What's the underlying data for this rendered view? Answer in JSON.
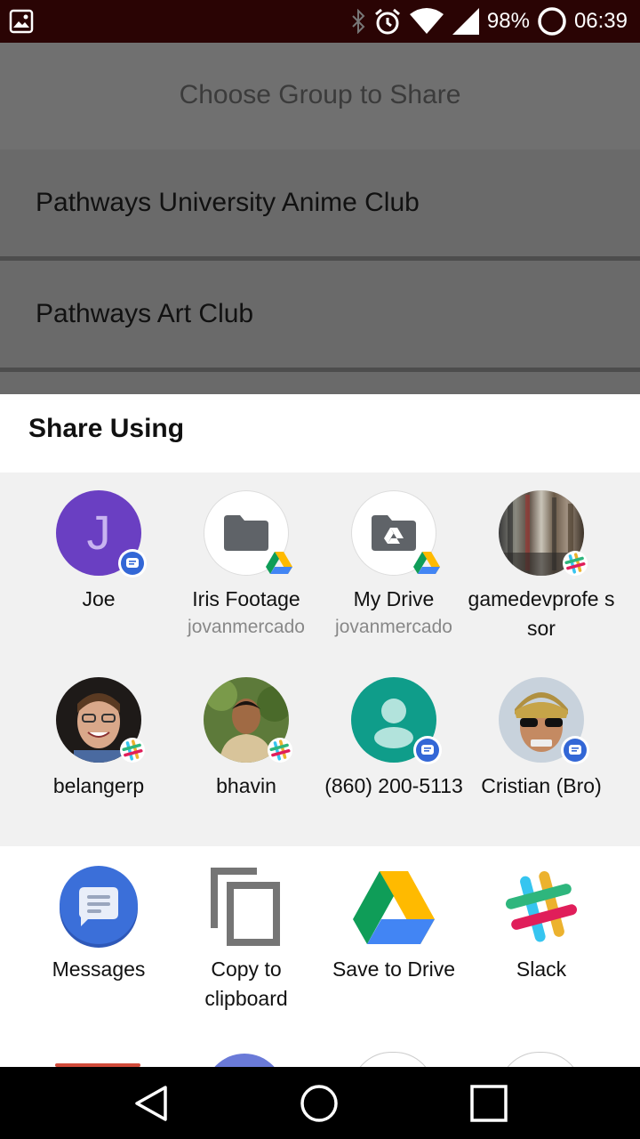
{
  "status_bar": {
    "battery": "98%",
    "time": "06:39",
    "icons": [
      "gallery-icon",
      "bluetooth-icon",
      "alarm-icon",
      "wifi-icon",
      "signal-icon",
      "battery-icon"
    ]
  },
  "app": {
    "title": "Choose Group to Share",
    "groups": [
      "Pathways University Anime Club",
      "Pathways Art Club"
    ]
  },
  "share_sheet": {
    "title": "Share Using",
    "direct_targets": [
      {
        "name": "Joe",
        "sub": "",
        "avatar_letter": "J",
        "badge": "messages-badge-icon"
      },
      {
        "name": "Iris Footage",
        "sub": "jovanmercado",
        "badge": "drive-badge-icon"
      },
      {
        "name": "My Drive",
        "sub": "jovanmercado",
        "badge": "drive-badge-icon"
      },
      {
        "name": "gamedevprofe ssor",
        "sub": "",
        "badge": "slack-badge-icon"
      },
      {
        "name": "belangerp",
        "sub": "",
        "badge": "slack-badge-icon"
      },
      {
        "name": "bhavin",
        "sub": "",
        "badge": "slack-badge-icon"
      },
      {
        "name": "(860) 200-5113",
        "sub": "",
        "badge": "messages-badge-icon"
      },
      {
        "name": "Cristian (Bro)",
        "sub": "",
        "badge": "messages-badge-icon"
      }
    ],
    "apps": [
      {
        "label": "Messages",
        "icon": "messages-app-icon"
      },
      {
        "label": "Copy to clipboard",
        "icon": "copy-icon"
      },
      {
        "label": "Save to Drive",
        "icon": "drive-app-icon"
      },
      {
        "label": "Slack",
        "icon": "slack-app-icon"
      }
    ]
  },
  "colors": {
    "joe_avatar": "#6a3fc2",
    "contact_avatar": "#0f9d8a",
    "messages_blue": "#3367d6",
    "status_bar": "#2a0404"
  },
  "nav_bar": {
    "buttons": [
      "back-icon",
      "home-icon",
      "recents-icon"
    ]
  }
}
